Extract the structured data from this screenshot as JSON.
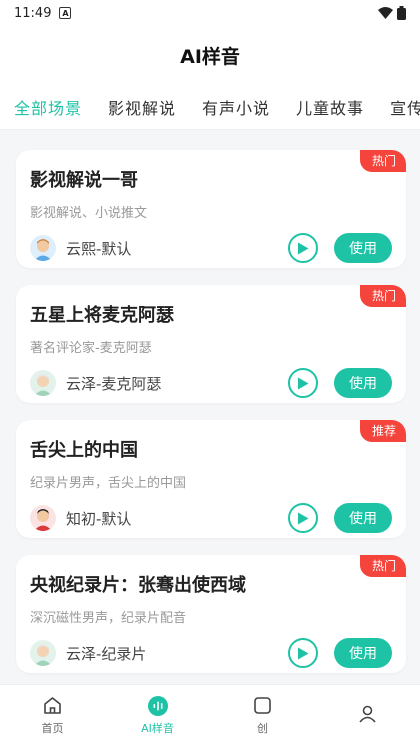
{
  "status_bar": {
    "time": "11:49",
    "app_icon": "A"
  },
  "header": {
    "title": "AI样音"
  },
  "tabs": [
    {
      "label": "全部场景",
      "active": true
    },
    {
      "label": "影视解说",
      "active": false
    },
    {
      "label": "有声小说",
      "active": false
    },
    {
      "label": "儿童故事",
      "active": false
    },
    {
      "label": "宣传",
      "active": false
    }
  ],
  "cards": [
    {
      "title": "影视解说一哥",
      "desc": "影视解说、小说推文",
      "voice": "云熙-默认",
      "badge": "热门",
      "avatar": "young-man-avatar"
    },
    {
      "title": "五星上将麦克阿瑟",
      "desc": "著名评论家-麦克阿瑟",
      "voice": "云泽-麦克阿瑟",
      "badge": "热门",
      "avatar": "older-man-avatar"
    },
    {
      "title": "舌尖上的中国",
      "desc": "纪录片男声，舌尖上的中国",
      "voice": "知初-默认",
      "badge": "推荐",
      "avatar": "man-red-shirt-avatar"
    },
    {
      "title": "央视纪录片：张骞出使西域",
      "desc": "深沉磁性男声，纪录片配音",
      "voice": "云泽-纪录片",
      "badge": "热门",
      "avatar": "older-man-avatar"
    }
  ],
  "use_label": "使用",
  "bottom_nav": [
    {
      "label": "首页",
      "icon": "home-icon",
      "active": false
    },
    {
      "label": "AI样音",
      "icon": "voice-wave-icon",
      "active": true
    },
    {
      "label": "创",
      "icon": "create-icon",
      "active": false
    },
    {
      "label": "",
      "icon": "profile-icon",
      "active": false
    }
  ],
  "colors": {
    "accent": "#1ec3a6",
    "badge": "#f5443b"
  }
}
